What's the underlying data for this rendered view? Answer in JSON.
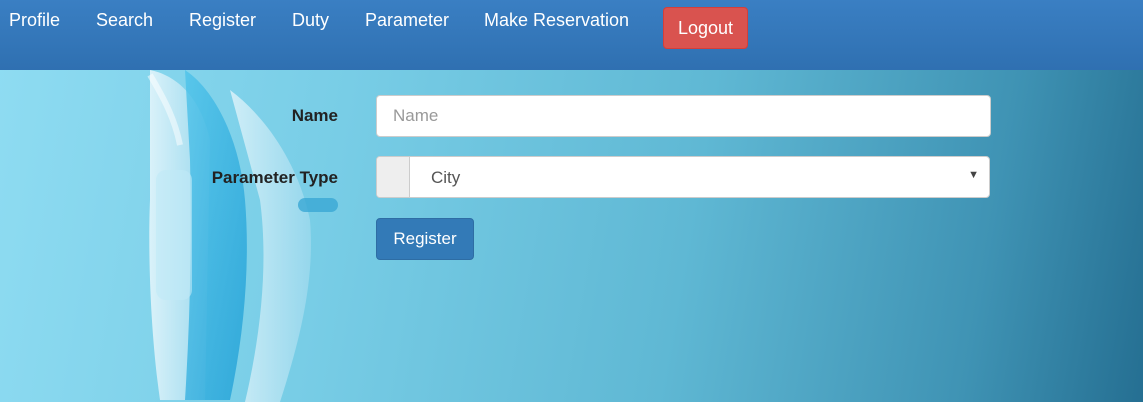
{
  "nav": {
    "items": [
      {
        "label": "Profile"
      },
      {
        "label": "Search"
      },
      {
        "label": "Register"
      },
      {
        "label": "Duty"
      },
      {
        "label": "Parameter"
      },
      {
        "label": "Make Reservation"
      }
    ],
    "logout_label": "Logout"
  },
  "form": {
    "name_label": "Name",
    "name_placeholder": "Name",
    "name_value": "",
    "type_label": "Parameter Type",
    "type_selected": "City",
    "register_label": "Register"
  },
  "colors": {
    "navbar": "#2f70b1",
    "logout": "#d9534f",
    "primary": "#337ab7"
  },
  "icons": {
    "select_arrow": "caret-down-icon",
    "background": "ceiling-fan-illustration"
  }
}
